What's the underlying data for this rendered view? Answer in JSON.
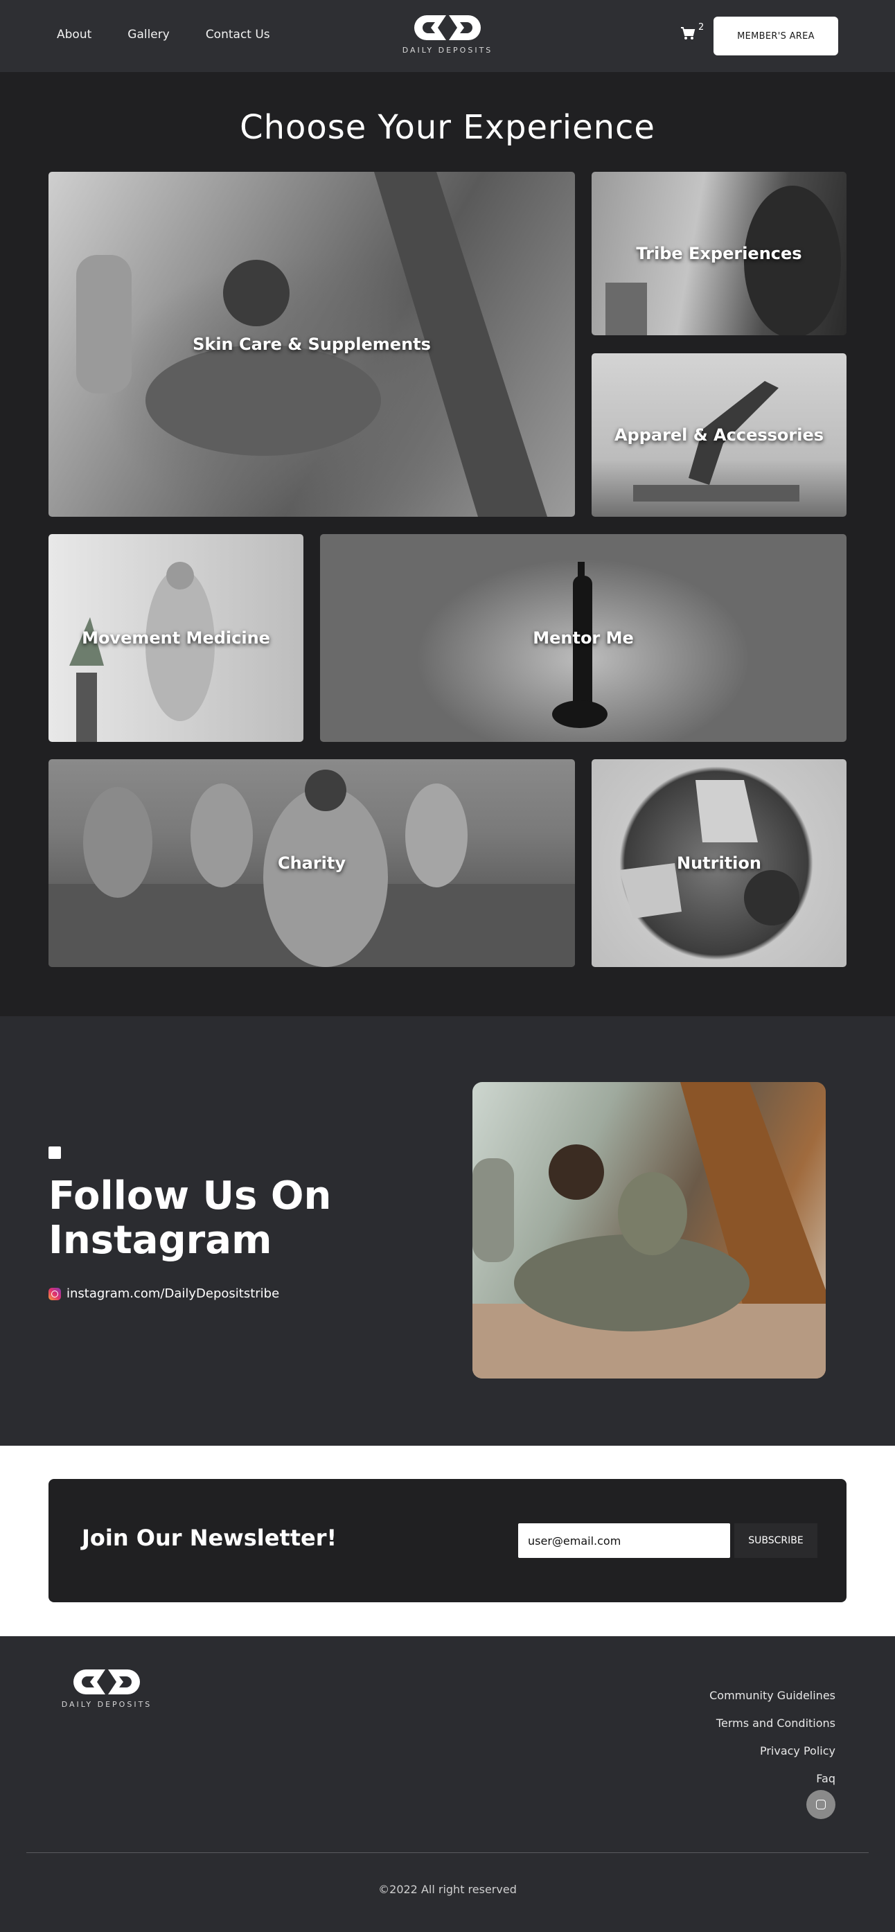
{
  "header": {
    "nav": [
      "About",
      "Gallery",
      "Contact Us"
    ],
    "logo_text": "DAILY DEPOSITS",
    "cart_count": "2",
    "member_button": "MEMBER'S AREA"
  },
  "experience": {
    "title": "Choose Your Experience",
    "tiles": [
      {
        "label": "Skin Care & Supplements"
      },
      {
        "label": "Tribe Experiences"
      },
      {
        "label": "Apparel & Accessories"
      },
      {
        "label": "Movement Medicine"
      },
      {
        "label": "Mentor Me"
      },
      {
        "label": "Charity"
      },
      {
        "label": "Nutrition"
      }
    ]
  },
  "instagram": {
    "title_line1": "Follow Us On",
    "title_line2": "Instagram",
    "handle": "instagram.com/DailyDepositstribe"
  },
  "newsletter": {
    "title": "Join Our Newsletter!",
    "email_value": "user@email.com",
    "button": "SUBSCRIBE"
  },
  "footer": {
    "logo_text": "DAILY DEPOSITS",
    "links": [
      "Community Guidelines",
      "Terms and Conditions",
      "Privacy Policy",
      "Faq"
    ],
    "copyright": "©2022 All right reserved"
  }
}
